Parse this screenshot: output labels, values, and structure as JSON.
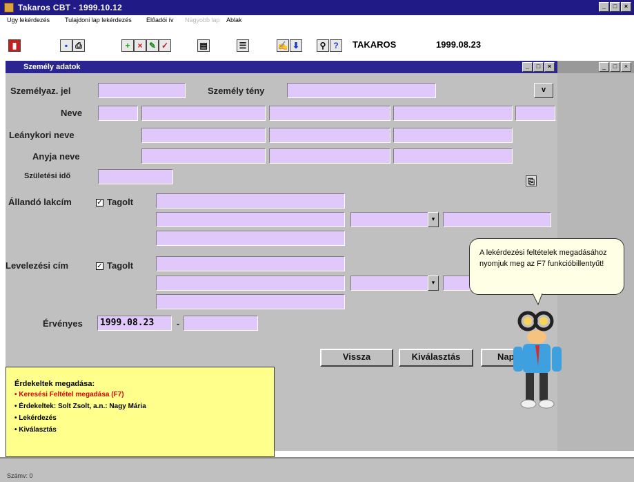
{
  "app": {
    "title": "Takaros CBT - 1999.10.12",
    "window_buttons": [
      "_",
      "□",
      "×"
    ]
  },
  "menu": [
    "Ugy lekérdezés",
    "Tulajdoni lap lekérdezés",
    "Előadói ív",
    "Nagyobb lap",
    "Ablak"
  ],
  "toolbar": {
    "label": "TAKAROS",
    "date": "1999.08.23",
    "icons": [
      "exit-icon",
      "save-icon",
      "print-icon",
      "add-icon",
      "delete-icon",
      "edit-icon",
      "check-icon",
      "report-icon",
      "list-icon",
      "text-icon",
      "download-icon",
      "query-icon",
      "help-icon"
    ]
  },
  "dialog": {
    "title": "Személy adatok",
    "labels": {
      "szemelyaz": "Személyaz. jel",
      "szemely_teny": "Személy tény",
      "neve": "Neve",
      "leanykori": "Leánykori neve",
      "anyja": "Anyja neve",
      "szuletesi": "Születési idő",
      "allando": "Állandó lakcím",
      "levelezesi": "Levelezési cím",
      "tagolt1": "Tagolt",
      "tagolt2": "Tagolt",
      "ervenyes": "Érvényes"
    },
    "fields": {
      "ervenyes_from": "1999.08.23",
      "ervenyes_sep": "-"
    },
    "expand_btn": "v",
    "buttons": {
      "vissza": "Vissza",
      "kivalasztas": "Kiválasztás",
      "nap": "Nap"
    }
  },
  "infobox": {
    "heading": "Érdekeltek megadása:",
    "items": [
      "• Keresési Feltétel megadása (F7)",
      "• Érdekeltek: Solt Zsolt, a.n.: Nagy Mária",
      "• Lekérdezés",
      "• Kiválasztás"
    ]
  },
  "bubble": {
    "text": "A lekérdezési feltételek megadásához nyomjuk meg az F7 funkcióbillentyűt!"
  },
  "status": {
    "text": "Számv: 0"
  },
  "colors": {
    "title": "#1f1a86",
    "field": "#e1c8fa",
    "info": "#ffff8c",
    "highlight": "#d00000"
  }
}
